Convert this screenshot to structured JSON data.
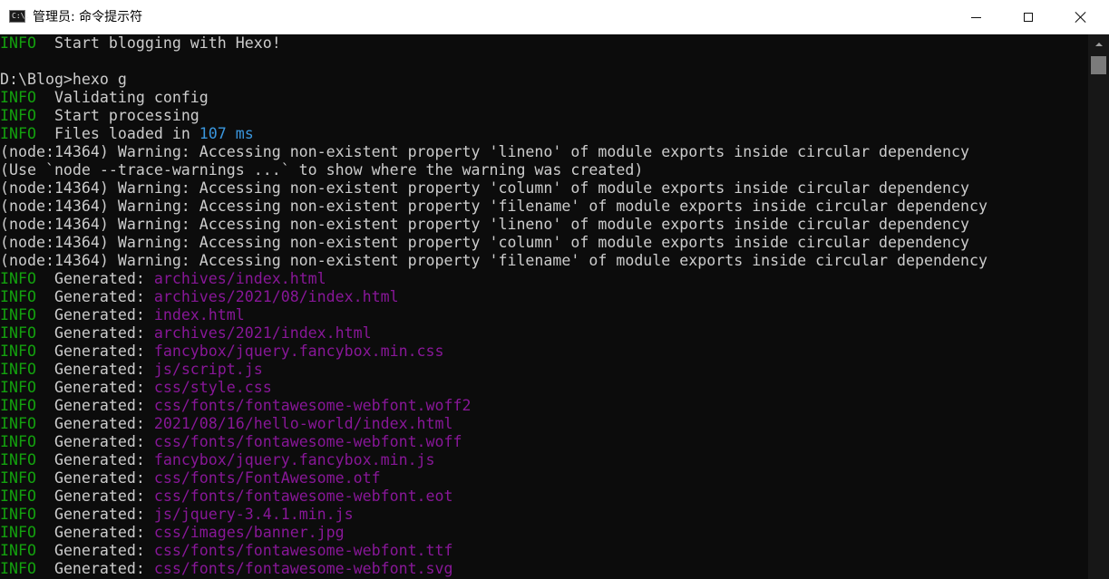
{
  "window": {
    "title": "管理员: 命令提示符",
    "icon_label": "C:\\."
  },
  "console": {
    "lines": [
      {
        "type": "info",
        "tag": "INFO",
        "text": "  Start blogging with Hexo!"
      },
      {
        "type": "plain",
        "text": ""
      },
      {
        "type": "plain",
        "text": "D:\\Blog>hexo g"
      },
      {
        "type": "info",
        "tag": "INFO",
        "text": "  Validating config"
      },
      {
        "type": "info",
        "tag": "INFO",
        "text": "  Start processing"
      },
      {
        "type": "info_num",
        "tag": "INFO",
        "text": "  Files loaded in ",
        "num": "107 ms"
      },
      {
        "type": "plain",
        "text": "(node:14364) Warning: Accessing non-existent property 'lineno' of module exports inside circular dependency"
      },
      {
        "type": "plain",
        "text": "(Use `node --trace-warnings ...` to show where the warning was created)"
      },
      {
        "type": "plain",
        "text": "(node:14364) Warning: Accessing non-existent property 'column' of module exports inside circular dependency"
      },
      {
        "type": "plain",
        "text": "(node:14364) Warning: Accessing non-existent property 'filename' of module exports inside circular dependency"
      },
      {
        "type": "plain",
        "text": "(node:14364) Warning: Accessing non-existent property 'lineno' of module exports inside circular dependency"
      },
      {
        "type": "plain",
        "text": "(node:14364) Warning: Accessing non-existent property 'column' of module exports inside circular dependency"
      },
      {
        "type": "plain",
        "text": "(node:14364) Warning: Accessing non-existent property 'filename' of module exports inside circular dependency"
      },
      {
        "type": "gen",
        "tag": "INFO",
        "label": "  Generated: ",
        "path": "archives/index.html"
      },
      {
        "type": "gen",
        "tag": "INFO",
        "label": "  Generated: ",
        "path": "archives/2021/08/index.html"
      },
      {
        "type": "gen",
        "tag": "INFO",
        "label": "  Generated: ",
        "path": "index.html"
      },
      {
        "type": "gen",
        "tag": "INFO",
        "label": "  Generated: ",
        "path": "archives/2021/index.html"
      },
      {
        "type": "gen",
        "tag": "INFO",
        "label": "  Generated: ",
        "path": "fancybox/jquery.fancybox.min.css"
      },
      {
        "type": "gen",
        "tag": "INFO",
        "label": "  Generated: ",
        "path": "js/script.js"
      },
      {
        "type": "gen",
        "tag": "INFO",
        "label": "  Generated: ",
        "path": "css/style.css"
      },
      {
        "type": "gen",
        "tag": "INFO",
        "label": "  Generated: ",
        "path": "css/fonts/fontawesome-webfont.woff2"
      },
      {
        "type": "gen",
        "tag": "INFO",
        "label": "  Generated: ",
        "path": "2021/08/16/hello-world/index.html"
      },
      {
        "type": "gen",
        "tag": "INFO",
        "label": "  Generated: ",
        "path": "css/fonts/fontawesome-webfont.woff"
      },
      {
        "type": "gen",
        "tag": "INFO",
        "label": "  Generated: ",
        "path": "fancybox/jquery.fancybox.min.js"
      },
      {
        "type": "gen",
        "tag": "INFO",
        "label": "  Generated: ",
        "path": "css/fonts/FontAwesome.otf"
      },
      {
        "type": "gen",
        "tag": "INFO",
        "label": "  Generated: ",
        "path": "css/fonts/fontawesome-webfont.eot"
      },
      {
        "type": "gen",
        "tag": "INFO",
        "label": "  Generated: ",
        "path": "js/jquery-3.4.1.min.js"
      },
      {
        "type": "gen",
        "tag": "INFO",
        "label": "  Generated: ",
        "path": "css/images/banner.jpg"
      },
      {
        "type": "gen",
        "tag": "INFO",
        "label": "  Generated: ",
        "path": "css/fonts/fontawesome-webfont.ttf"
      },
      {
        "type": "gen",
        "tag": "INFO",
        "label": "  Generated: ",
        "path": "css/fonts/fontawesome-webfont.svg"
      }
    ]
  },
  "colors": {
    "background": "#0c0c0c",
    "text": "#cccccc",
    "info_tag": "#13a10e",
    "generated_path": "#881798",
    "number": "#3a96dd"
  },
  "icons": [
    "cmd-app-icon",
    "minimize-icon",
    "maximize-icon",
    "close-icon",
    "scroll-up-arrow-icon"
  ]
}
